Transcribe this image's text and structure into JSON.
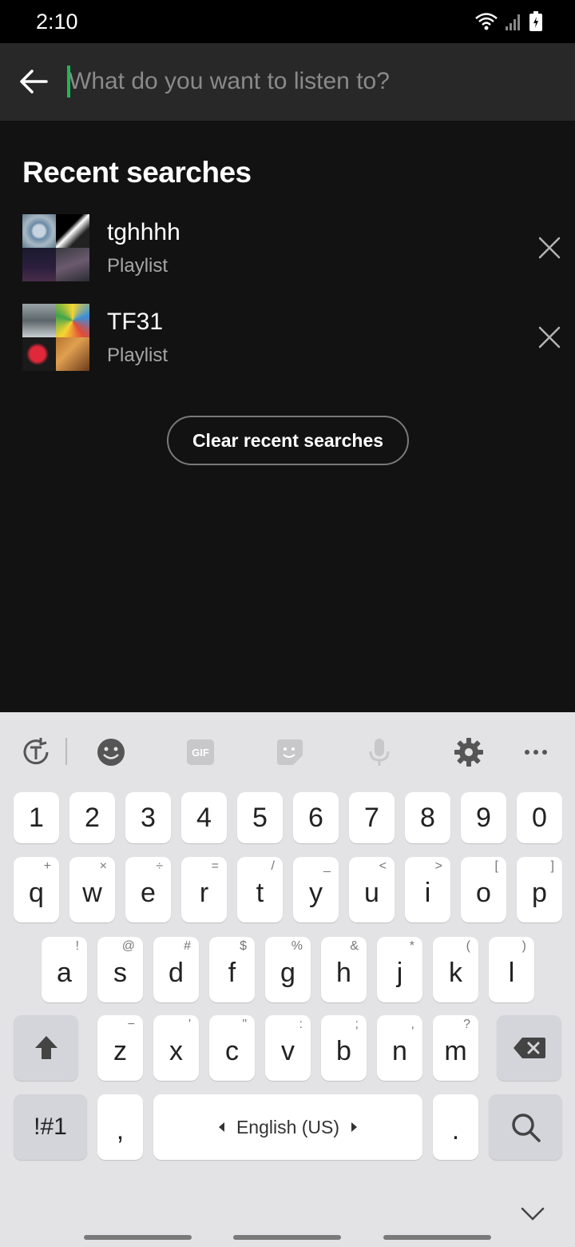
{
  "status": {
    "time": "2:10"
  },
  "search": {
    "placeholder": "What do you want to listen to?"
  },
  "recent": {
    "title": "Recent searches",
    "items": [
      {
        "title": "tghhhh",
        "subtitle": "Playlist"
      },
      {
        "title": "TF31",
        "subtitle": "Playlist"
      }
    ],
    "clear_label": "Clear recent searches"
  },
  "keyboard": {
    "numbers": [
      "1",
      "2",
      "3",
      "4",
      "5",
      "6",
      "7",
      "8",
      "9",
      "0"
    ],
    "row1": {
      "keys": [
        "q",
        "w",
        "e",
        "r",
        "t",
        "y",
        "u",
        "i",
        "o",
        "p"
      ],
      "sup": [
        "+",
        "×",
        "÷",
        "=",
        "/",
        "_",
        "<",
        ">",
        "[",
        "]"
      ]
    },
    "row2": {
      "keys": [
        "a",
        "s",
        "d",
        "f",
        "g",
        "h",
        "j",
        "k",
        "l"
      ],
      "sup": [
        "!",
        "@",
        "#",
        "$",
        "%",
        "&",
        "*",
        "(",
        ")"
      ]
    },
    "row3": {
      "keys": [
        "z",
        "x",
        "c",
        "v",
        "b",
        "n",
        "m"
      ],
      "sup": [
        "−",
        "'",
        "\"",
        ":",
        ";",
        ",",
        "?"
      ]
    },
    "symbols_label": "!#1",
    "comma": ",",
    "space_label": "English (US)",
    "period": ".",
    "gif_label": "GIF"
  },
  "colors": {
    "accent": "#1db954",
    "background": "#121212",
    "search_bar": "#282828",
    "keyboard": "#e3e3e5"
  }
}
